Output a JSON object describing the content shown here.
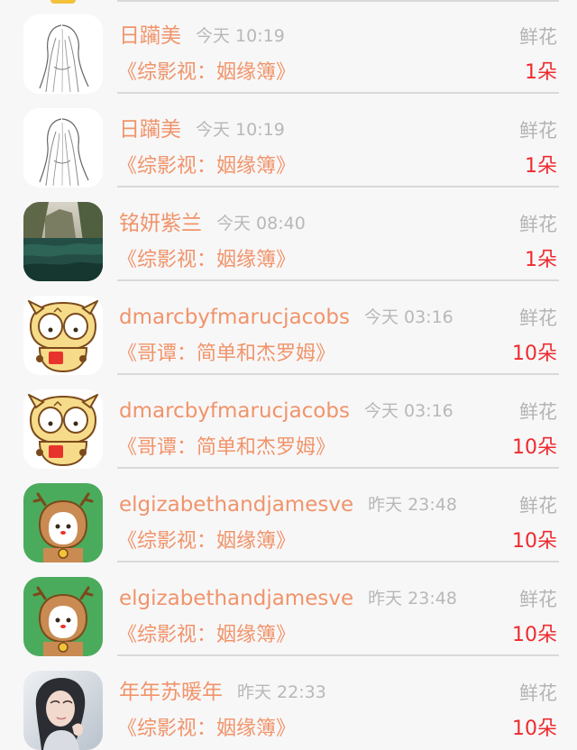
{
  "records": [
    {
      "avatar_icon": "sketch-girl-avatar-icon",
      "name": "日躏美",
      "time": "今天 10:19",
      "gift_type": "鲜花",
      "book": "《综影视：姻缘簿》",
      "count": "1朵"
    },
    {
      "avatar_icon": "sketch-girl-avatar-icon",
      "name": "日躏美",
      "time": "今天 10:19",
      "gift_type": "鲜花",
      "book": "《综影视：姻缘簿》",
      "count": "1朵"
    },
    {
      "avatar_icon": "green-lake-avatar-icon",
      "name": "铭妍紫兰",
      "time": "今天 08:40",
      "gift_type": "鲜花",
      "book": "《综影视：姻缘簿》",
      "count": "1朵"
    },
    {
      "avatar_icon": "cartoon-cat-avatar-icon",
      "name": "dmarcbyfmarucjacobs",
      "time": "今天 03:16",
      "gift_type": "鲜花",
      "book": "《哥谭：简单和杰罗姆》",
      "count": "10朵"
    },
    {
      "avatar_icon": "cartoon-cat-avatar-icon",
      "name": "dmarcbyfmarucjacobs",
      "time": "今天 03:16",
      "gift_type": "鲜花",
      "book": "《哥谭：简单和杰罗姆》",
      "count": "10朵"
    },
    {
      "avatar_icon": "reindeer-avatar-icon",
      "name": "elgizabethandjamesve",
      "time": "昨天 23:48",
      "gift_type": "鲜花",
      "book": "《综影视：姻缘簿》",
      "count": "10朵"
    },
    {
      "avatar_icon": "reindeer-avatar-icon",
      "name": "elgizabethandjamesve",
      "time": "昨天 23:48",
      "gift_type": "鲜花",
      "book": "《综影视：姻缘簿》",
      "count": "10朵"
    },
    {
      "avatar_icon": "portrait-photo-avatar-icon",
      "name": "年年苏暖年",
      "time": "昨天 22:33",
      "gift_type": "鲜花",
      "book": "《综影视：姻缘簿》",
      "count": "10朵"
    }
  ],
  "colors": {
    "name_text": "#f0946a",
    "time_text": "#b8b8b8",
    "gift_type_text": "#b4b4b4",
    "count_text": "#ee2b2f",
    "background": "#f8f7f8",
    "divider": "#d9d9d9"
  }
}
